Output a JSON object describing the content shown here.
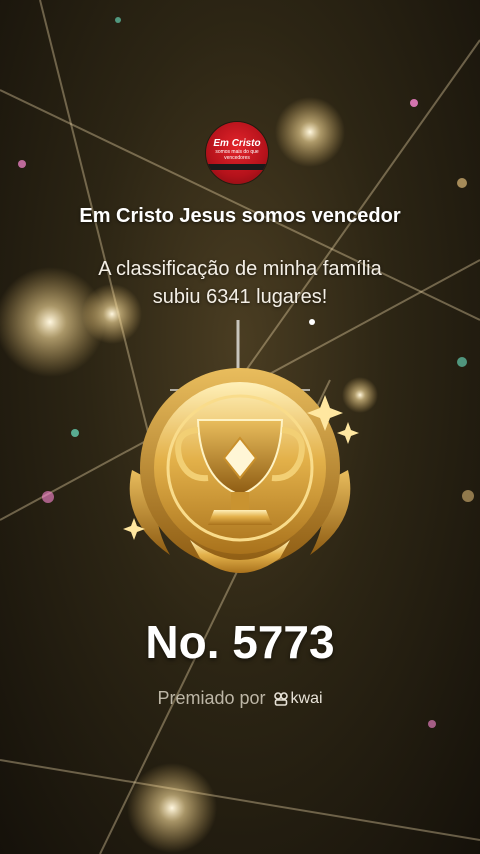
{
  "profile": {
    "avatar_line1": "Em Cristo",
    "avatar_line2": "somos mais do que vencedores"
  },
  "achievement": {
    "name": "Em Cristo Jesus somos vencedor",
    "message": "A classificação de minha família subiu 6341 lugares!",
    "rank": "No. 5773",
    "awarded_by_label": "Premiado por",
    "brand": "kwai"
  },
  "icons": {
    "badge": "gold-trophy-badge-icon",
    "brand_logo": "kwai-logo-icon"
  },
  "colors": {
    "background": "#2c2514",
    "gold": "#d9a93c",
    "text": "#ffffff",
    "muted": "#bdb6a6"
  }
}
